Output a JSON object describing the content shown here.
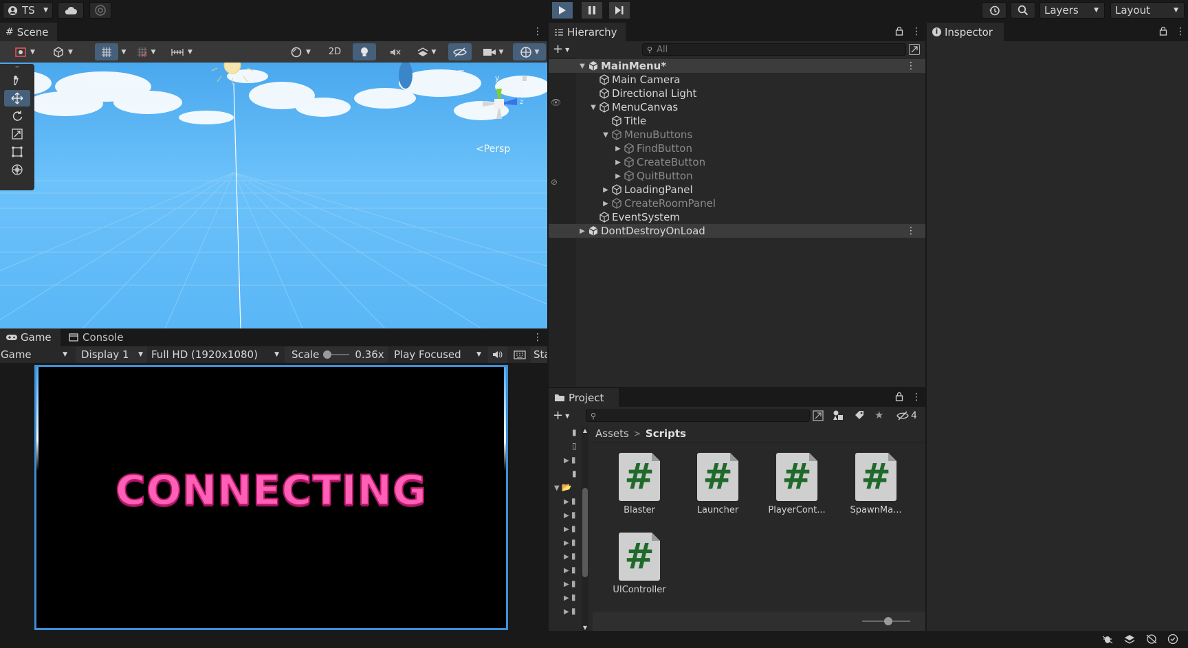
{
  "topbar": {
    "account": "TS",
    "layers": "Layers",
    "layout": "Layout"
  },
  "scene": {
    "tab": "Scene",
    "toolbar_2d": "2D",
    "persp_label": "Persp",
    "gizmo_y": "y",
    "gizmo_z": "z"
  },
  "game": {
    "tab_game": "Game",
    "tab_console": "Console",
    "view_select": "Game",
    "display": "Display 1",
    "resolution": "Full HD (1920x1080)",
    "scale_label": "Scale",
    "scale_value": "0.36x",
    "scale_fraction": 0.0,
    "play_mode": "Play Focused",
    "stats": "Sta",
    "overlay_text": "CONNECTING"
  },
  "hierarchy": {
    "tab": "Hierarchy",
    "search_placeholder": "All",
    "items": [
      {
        "label": "MainMenu*",
        "kind": "scene"
      },
      {
        "label": "Main Camera"
      },
      {
        "label": "Directional Light"
      },
      {
        "label": "MenuCanvas"
      },
      {
        "label": "Title"
      },
      {
        "label": "MenuButtons"
      },
      {
        "label": "FindButton"
      },
      {
        "label": "CreateButton"
      },
      {
        "label": "QuitButton"
      },
      {
        "label": "LoadingPanel"
      },
      {
        "label": "CreateRoomPanel"
      },
      {
        "label": "EventSystem"
      },
      {
        "label": "DontDestroyOnLoad",
        "kind": "scene"
      }
    ]
  },
  "inspector": {
    "tab": "Inspector"
  },
  "project": {
    "tab": "Project",
    "hidden_count": "4",
    "breadcrumb": [
      "Assets",
      "Scripts"
    ],
    "assets": [
      "Blaster",
      "Launcher",
      "PlayerCont...",
      "SpawnMa...",
      "UIController"
    ]
  },
  "colors": {
    "play_accent": "#46607c",
    "game_border": "#3d8fd8",
    "connecting_pink": "#ff5fb4",
    "script_hash": "#1f6a2a"
  }
}
